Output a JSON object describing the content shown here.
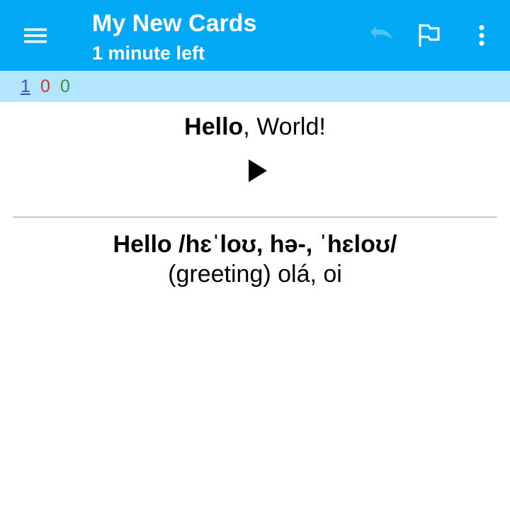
{
  "toolbar": {
    "title": "My New Cards",
    "subtitle": "1 minute left",
    "icons": {
      "menu": "hamburger-menu-icon",
      "undo": "undo-icon",
      "flag": "flag-icon",
      "more": "more-vertical-icon"
    },
    "colors": {
      "background": "#03a9f4",
      "undo_disabled": "#4fc3f7"
    }
  },
  "counts": {
    "new": "1",
    "learning": "0",
    "review": "0",
    "colors": {
      "bar_background": "#b3e5fc",
      "new": "#3f51b5",
      "learning": "#d32f2f",
      "review": "#388e3c"
    }
  },
  "card": {
    "front": {
      "bold_part": "Hello",
      "rest": ", World!"
    },
    "audio_icon": "play-icon",
    "back": {
      "word": "Hello /hɛˈloʊ, hə-, ˈhɛloʊ/",
      "meaning": "(greeting) olá, oi"
    }
  }
}
